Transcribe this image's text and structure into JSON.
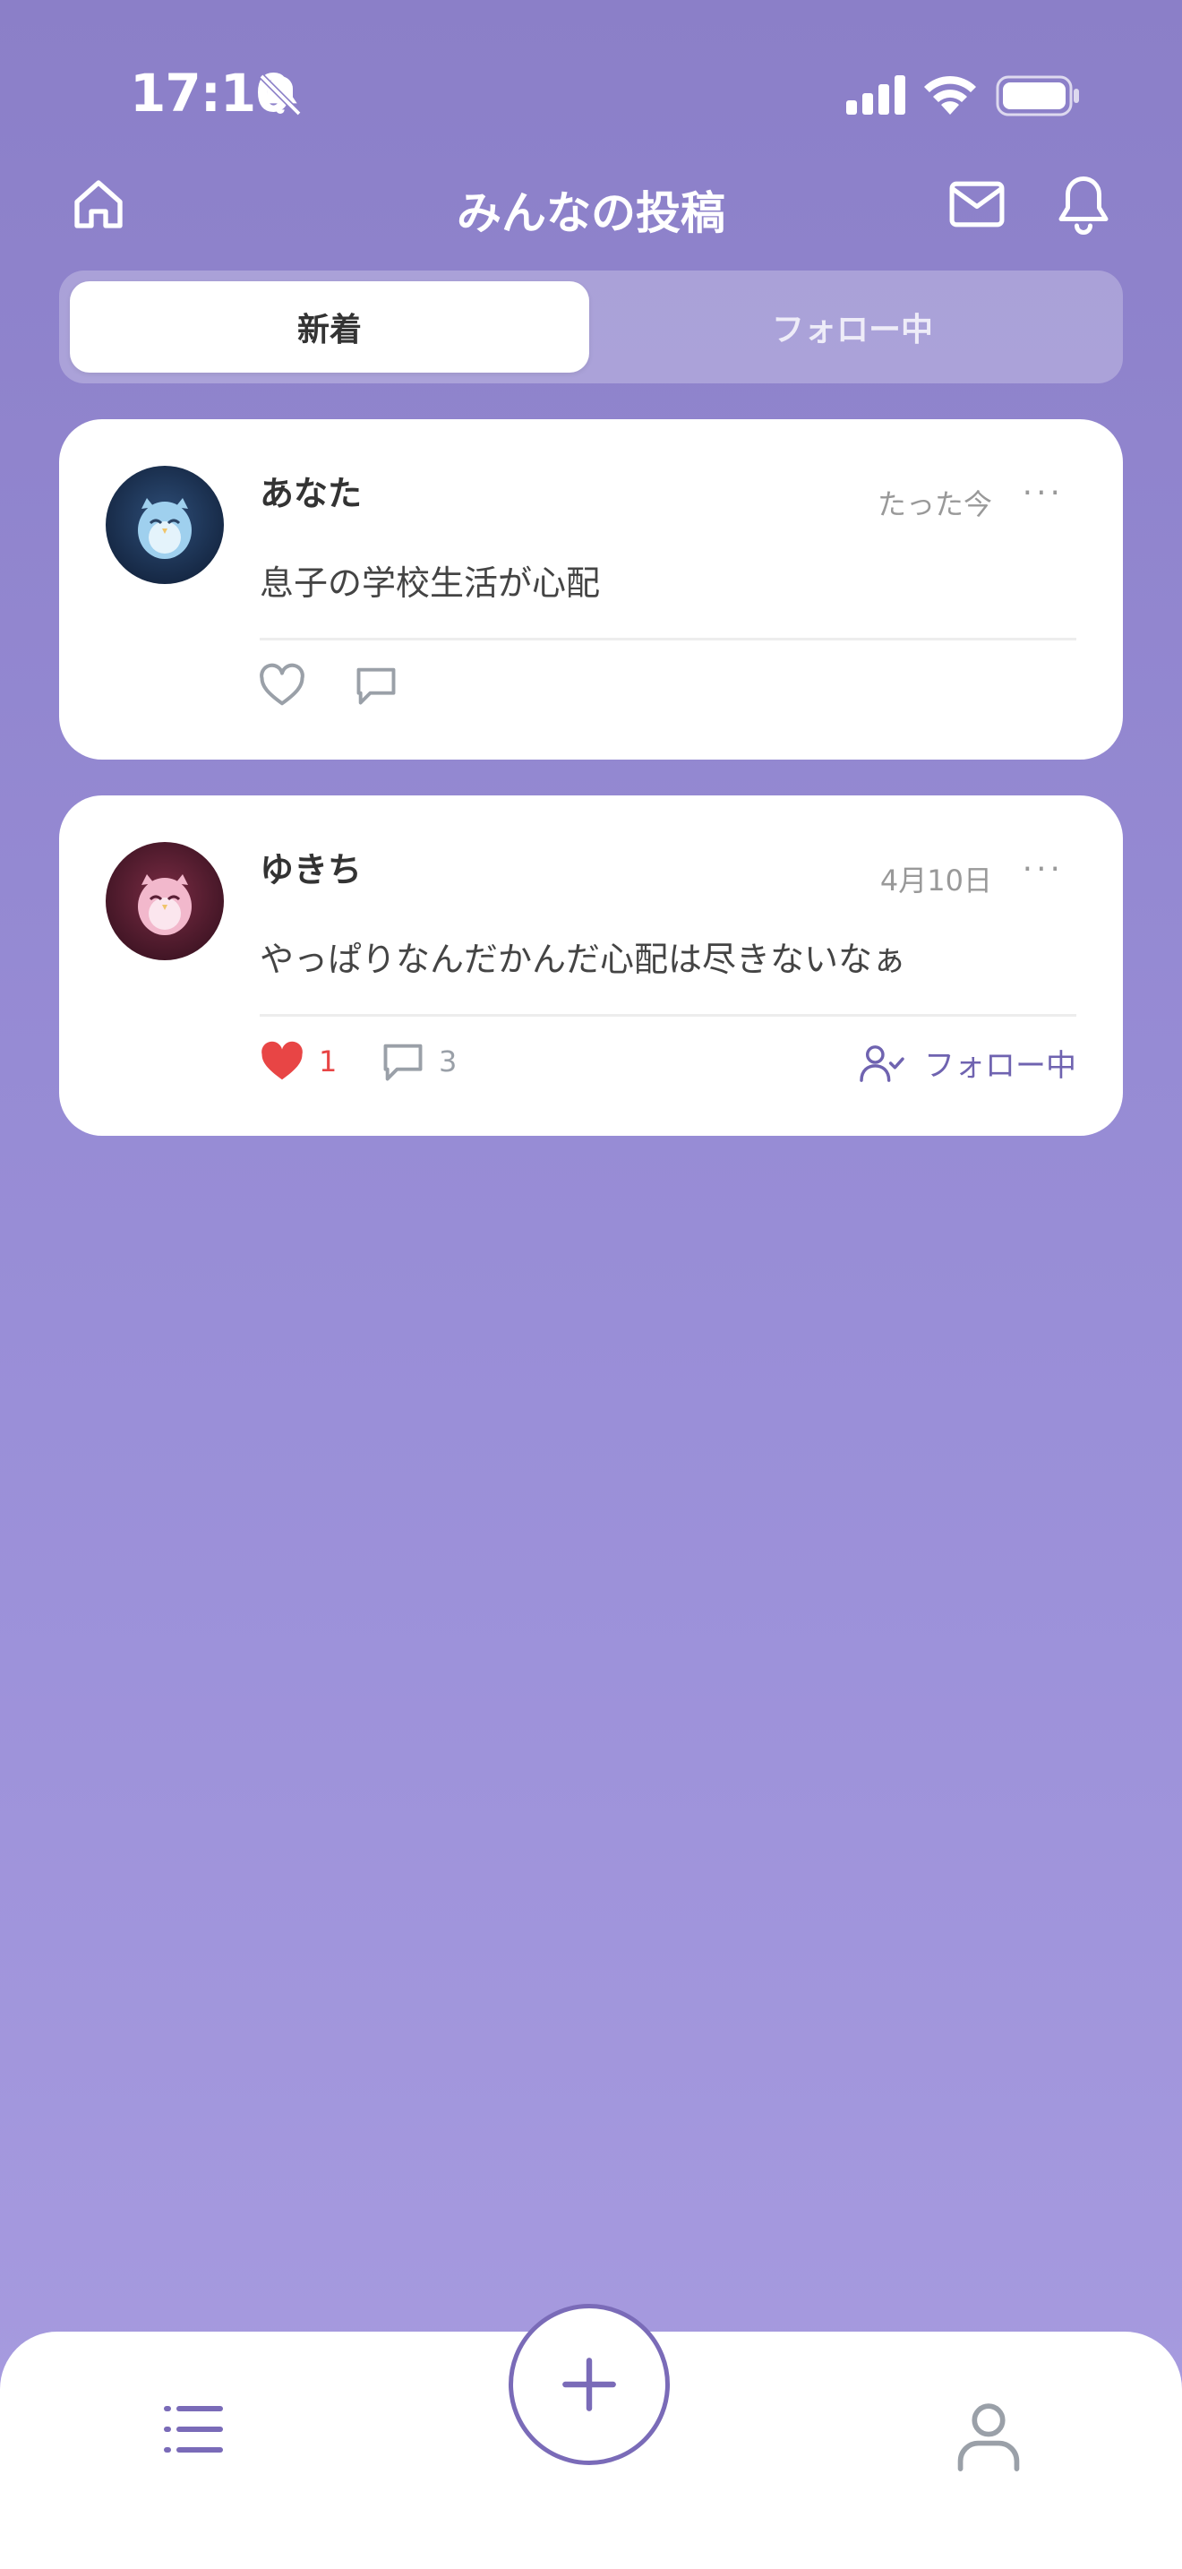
{
  "status_bar": {
    "time": "17:10",
    "icons": [
      "bell-slash-icon",
      "cellular-signal-icon",
      "wifi-icon",
      "battery-icon"
    ]
  },
  "header": {
    "title": "みんなの投稿",
    "icons": [
      "home-icon",
      "mail-icon",
      "bell-icon"
    ]
  },
  "tabs": [
    {
      "label": "新着",
      "active": true
    },
    {
      "label": "フォロー中",
      "active": false
    }
  ],
  "posts": [
    {
      "username": "あなた",
      "timestamp": "たった今",
      "text": "息子の学校生活が心配",
      "likes": "",
      "comments": "",
      "liked": false,
      "avatar": "blue-owl-avatar"
    },
    {
      "username": "ゆきち",
      "timestamp": "4月10日",
      "text": "やっぱりなんだかんだ心配は尽きないなぁ",
      "likes": "1",
      "comments": "3",
      "liked": true,
      "follow_label": "フォロー中",
      "avatar": "pink-owl-avatar"
    }
  ],
  "bottom_nav": {
    "items": [
      "list-icon",
      "plus-icon",
      "user-icon"
    ]
  },
  "colors": {
    "accent": "#7a6bb8",
    "like": "#e84545",
    "background_top": "#8b7fc8",
    "background_bottom": "#a89ce0"
  }
}
